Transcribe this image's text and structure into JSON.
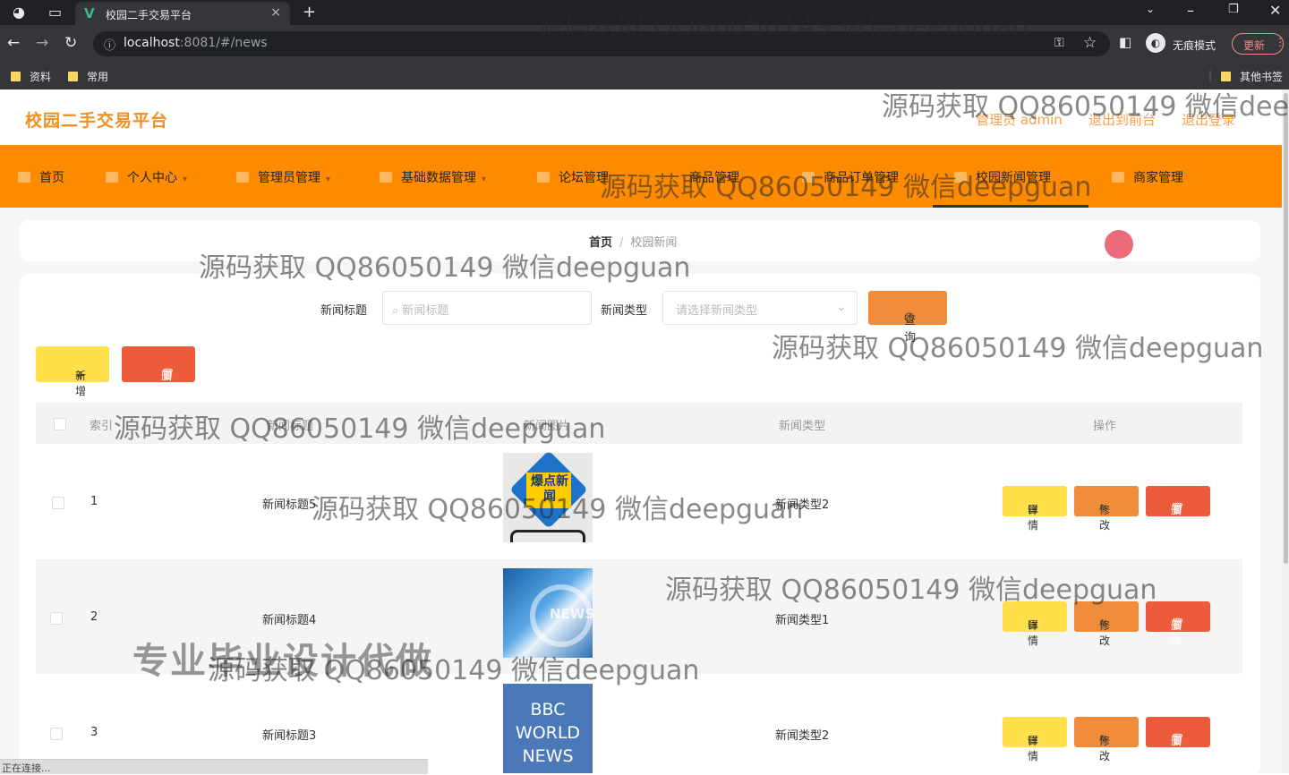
{
  "browser": {
    "tab_title": "校园二手交易平台",
    "tab_close": "×",
    "new_tab": "+",
    "url_host": "localhost",
    "url_rest": ":8081/#/news",
    "incognito_label": "无痕模式",
    "update_label": "更新",
    "bookmarks": [
      "资料",
      "常用"
    ],
    "other_bookmarks": "其他书签"
  },
  "app": {
    "logo": "校园二手交易平台",
    "header_links": [
      "管理员 admin",
      "退出到前台",
      "退出登录"
    ],
    "nav": [
      "首页",
      "个人中心",
      "管理员管理",
      "基础数据管理",
      "论坛管理",
      "商品管理",
      "商品订单管理",
      "校园新闻管理",
      "商家管理"
    ],
    "active_nav": "校园新闻管理"
  },
  "breadcrumb": {
    "home": "首页",
    "sep": "/",
    "current": "校园新闻"
  },
  "search": {
    "title_label": "新闻标题",
    "title_placeholder": "新闻标题",
    "type_label": "新闻类型",
    "type_placeholder": "请选择新闻类型",
    "query_button": "查询"
  },
  "toolbar": {
    "add_label": "新增",
    "delete_label": "删除"
  },
  "table": {
    "headers": [
      "索引",
      "新闻标题",
      "新闻图片",
      "新闻类型",
      "操作"
    ],
    "rows": [
      {
        "index": "1",
        "title": "新闻标题5",
        "type": "新闻类型2",
        "image_text": "爆点新闻"
      },
      {
        "index": "2",
        "title": "新闻标题4",
        "type": "新闻类型1",
        "image_text": "NEWS"
      },
      {
        "index": "3",
        "title": "新闻标题3",
        "type": "新闻类型2",
        "image_text": "BBC WORLD NEWS"
      }
    ],
    "actions": {
      "detail": "详情",
      "edit": "修改",
      "delete": "删除"
    }
  },
  "watermarks": {
    "text": "源码获取 QQ86050149 微信deepguan",
    "text_cut": "源码获取 QQ86050149 微信deep",
    "promo": "专业毕业设计代做"
  },
  "status": "正在连接...",
  "colors": {
    "nav_bg": "#ff8c00",
    "logo": "#f09020",
    "detail_btn": "#ffe04a",
    "edit_btn": "#f08c3a",
    "delete_btn": "#ec5b3a"
  }
}
